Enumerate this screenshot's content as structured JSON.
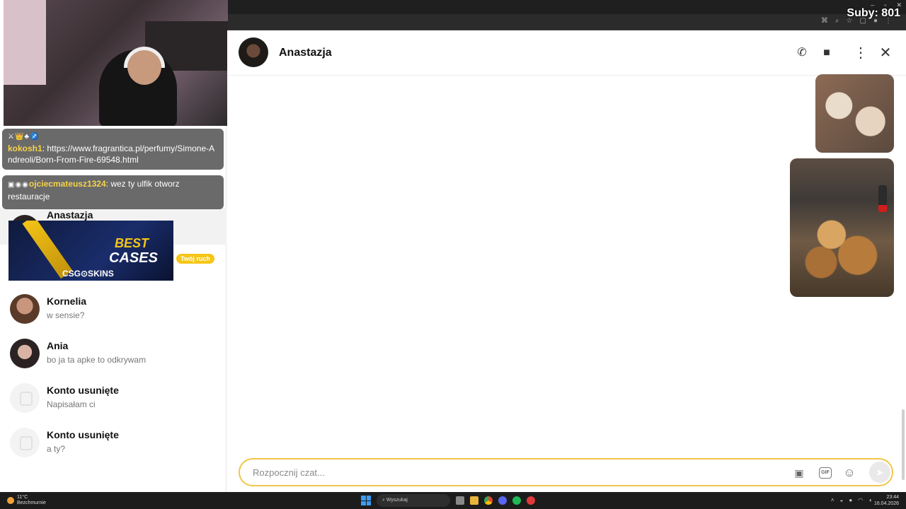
{
  "stream_overlay": {
    "subs_label": "Suby: 801",
    "chat_messages": [
      {
        "badges": "⚔👑♣♐",
        "user": "kokosh1",
        "text": "https://www.fragrantica.pl/perfumy/Simone-Andreoli/Born-From-Fire-69548.html"
      },
      {
        "badges": "▣◉◉",
        "user": "ojciecmateusz1324",
        "text": "wez ty ulfik otworz restauracje"
      }
    ],
    "ad": {
      "line1": "BEST",
      "line2": "CASES",
      "brand": "CSG⊙SKINS"
    }
  },
  "conversations": [
    {
      "name": "Anastazja",
      "preview": "",
      "badge": "Twój ruch",
      "active": true
    },
    {
      "name": "Kornelia",
      "preview": "w sensie?"
    },
    {
      "name": "Ania",
      "preview": "bo ja ta apke to odkrywam"
    },
    {
      "name": "Konto usunięte",
      "preview": "Napisałam ci"
    },
    {
      "name": "Konto usunięte",
      "preview": "a ty?"
    }
  ],
  "chat": {
    "contact_name": "Anastazja",
    "composer_placeholder": "Rozpocznij czat..."
  },
  "taskbar": {
    "weather_temp": "11°C",
    "weather_desc": "Bezchmurnie",
    "search_label": "Wyszukaj",
    "time": "23:44",
    "date": "16.04.2026"
  },
  "colors": {
    "accent": "#f0c64a",
    "badge": "#f5c518",
    "chat_user": "#f5d24a"
  }
}
